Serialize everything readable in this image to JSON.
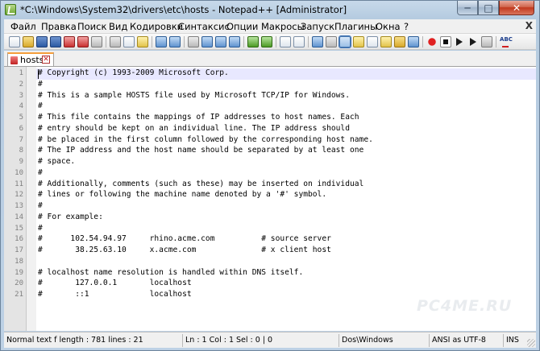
{
  "window": {
    "title": "*C:\\Windows\\System32\\drivers\\etc\\hosts - Notepad++ [Administrator]"
  },
  "menu": {
    "items": [
      "Файл",
      "Правка",
      "Поиск",
      "Вид",
      "Кодировки",
      "Синтаксис",
      "Опции",
      "Макросы",
      "Запуск",
      "Плагины",
      "Окна",
      "?"
    ],
    "close_glyph": "X"
  },
  "toolbar": {
    "icons": [
      "new-icon",
      "open-icon",
      "save-icon",
      "save-all-icon",
      "close-icon",
      "close-all-icon",
      "print-icon",
      "cut-icon",
      "copy-icon",
      "paste-icon",
      "undo-icon",
      "redo-icon",
      "find-icon",
      "replace-icon",
      "zoom-in-icon",
      "zoom-out-icon",
      "sync-vertical-icon",
      "sync-horizontal-icon",
      "word-wrap-icon",
      "all-chars-icon",
      "indent-guide-icon",
      "user-lang-icon",
      "doc-map-icon",
      "function-list-icon",
      "folder-workspace-icon",
      "monitor-icon",
      "record-macro-icon",
      "stop-macro-icon",
      "play-macro-icon",
      "play-multiple-icon",
      "save-macro-icon",
      "spell-check-icon"
    ],
    "spell_label": "ABC"
  },
  "tabs": [
    {
      "label": "hosts",
      "icon": "unsaved-file-icon",
      "active": true
    }
  ],
  "editor": {
    "lines": [
      "# Copyright (c) 1993-2009 Microsoft Corp.",
      "#",
      "# This is a sample HOSTS file used by Microsoft TCP/IP for Windows.",
      "#",
      "# This file contains the mappings of IP addresses to host names. Each",
      "# entry should be kept on an individual line. The IP address should",
      "# be placed in the first column followed by the corresponding host name.",
      "# The IP address and the host name should be separated by at least one",
      "# space.",
      "#",
      "# Additionally, comments (such as these) may be inserted on individual",
      "# lines or following the machine name denoted by a '#' symbol.",
      "#",
      "# For example:",
      "#",
      "#      102.54.94.97     rhino.acme.com          # source server",
      "#       38.25.63.10     x.acme.com              # x client host",
      "",
      "# localhost name resolution is handled within DNS itself.",
      "#\t127.0.0.1       localhost",
      "#\t::1             localhost"
    ],
    "watermark": "PC4ME.RU"
  },
  "status": {
    "type_length": "Normal text f length : 781    lines : 21",
    "position": "Ln : 1    Col : 1    Sel : 0 | 0",
    "eol": "Dos\\Windows",
    "encoding": "ANSI as UTF-8",
    "mode": "INS"
  },
  "colors": {
    "current_line": "#e8e8ff",
    "tab_accent": "#f59e3b",
    "close_button": "#c0381e"
  }
}
